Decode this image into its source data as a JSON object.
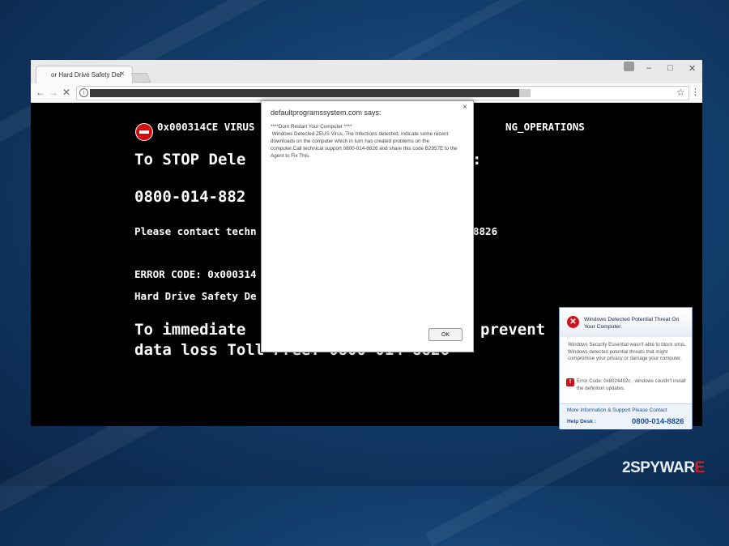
{
  "browser": {
    "tab_title": "or Hard Drive Safety Del",
    "tab_close": "×",
    "window_controls": {
      "minimize": "–",
      "maximize": "□",
      "close": "✕"
    },
    "nav": {
      "back": "←",
      "forward": "→",
      "reload": "✕"
    },
    "star": "☆",
    "menu": "⋮",
    "info": "i"
  },
  "page": {
    "line1": "0x000314CE VIRUS",
    "line1_tail": "NG_OPERATIONS",
    "line2": "To STOP Dele",
    "line2_tail": ":",
    "line3": "0800-014-882",
    "line4": "Please contact techn",
    "line4_tail": "8826",
    "line5": "ERROR CODE: 0x000314",
    "line6": "Hard Drive Safety De",
    "line7_start": "To immediate",
    "line7_tail": "prevent",
    "line8": "data loss Toll Free: 0800-014-8826"
  },
  "dialog": {
    "title": "defaultprogramssystem.com says:",
    "close": "×",
    "message": "****Dont Restart Your Computer ****\n Windows Detected ZEUS Virus, The Infections detected, indicate some recent downloads on the computer which in turn has created problems on the computer.Call technical support 0800-014-8826 and share this code B2957E to the Agent to Fix This.",
    "ok_label": "OK"
  },
  "notification": {
    "title": "Windows Detected Potential Threat On Your Computer.",
    "body": "Windows Security Essential wasn't able to block virus. Windows detected potential threats that might compromise your privacy or damage your computer.",
    "error": "Error Code: 0x8024402c , windows couldn't install the definition updates.",
    "link": "More Information & Support Please Contact",
    "help_label": "Help Desk :",
    "phone": "0800-014-8826"
  },
  "watermark": {
    "prefix": "2",
    "brand_a": "SPYWAR",
    "brand_b": "E"
  },
  "colors": {
    "stop_red": "#d60b0b",
    "link_blue": "#1a4f9c",
    "watermark_red": "#d71c1c"
  }
}
